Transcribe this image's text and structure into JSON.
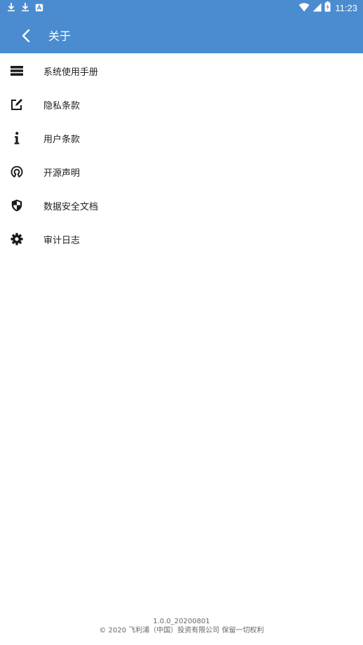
{
  "status_bar": {
    "time": "11:23",
    "icons": [
      "download-icon",
      "download-icon",
      "notification-icon",
      "wifi-icon",
      "signal-icon",
      "battery-charging-icon"
    ]
  },
  "toolbar": {
    "title": "关于",
    "back_icon": "chevron-left-icon"
  },
  "menu": {
    "items": [
      {
        "label": "系统使用手册",
        "icon": "list-icon"
      },
      {
        "label": "隐私条款",
        "icon": "edit-icon"
      },
      {
        "label": "用户条款",
        "icon": "info-icon"
      },
      {
        "label": "开源声明",
        "icon": "open-source-icon"
      },
      {
        "label": "数据安全文档",
        "icon": "shield-icon"
      },
      {
        "label": "审计日志",
        "icon": "gear-icon"
      }
    ]
  },
  "footer": {
    "version": "1.0.0_20200801",
    "copyright": "© 2020 飞利浦（中国）投资有限公司 保留一切权利"
  },
  "colors": {
    "header": "#4a8ccf",
    "icon": "#1a1a1a",
    "text": "#222222",
    "footer_text": "#666666"
  }
}
